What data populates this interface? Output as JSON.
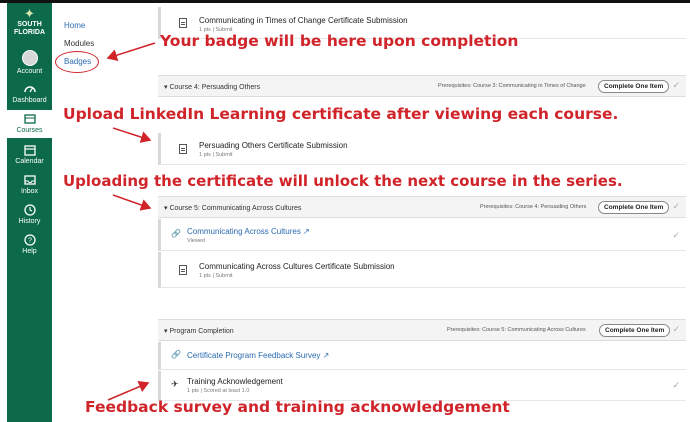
{
  "global_nav": {
    "logo": {
      "line1": "SOUTH",
      "line2": "FLORIDA"
    },
    "items": [
      {
        "label": "Account"
      },
      {
        "label": "Dashboard"
      },
      {
        "label": "Courses"
      },
      {
        "label": "Calendar"
      },
      {
        "label": "Inbox"
      },
      {
        "label": "History"
      },
      {
        "label": "Help"
      }
    ]
  },
  "course_nav": {
    "links": [
      "Home",
      "Modules",
      "Badges"
    ]
  },
  "content": {
    "item_top": {
      "title": "Communicating in Times of Change Certificate Submission",
      "meta": "1 pts | Submit"
    },
    "module4": {
      "title": "Course 4: Persuading Others",
      "prereq": "Prerequisites: Course 3: Communicating in Times of Change",
      "button": "Complete One Item"
    },
    "item_m4": {
      "title": "Persuading Others Certificate Submission",
      "meta": "1 pts | Submit"
    },
    "module5": {
      "title": "Course 5: Communicating Across Cultures",
      "prereq": "Prerequisites: Course 4: Persuading Others",
      "button": "Complete One Item"
    },
    "item_m5a": {
      "title": "Communicating Across Cultures",
      "meta": "Viewed"
    },
    "item_m5b": {
      "title": "Communicating Across Cultures Certificate Submission",
      "meta": "1 pts | Submit"
    },
    "module_pc": {
      "title": "Program Completion",
      "prereq": "Prerequisites: Course 5: Communicating Across Cultures",
      "button": "Complete One Item"
    },
    "item_pc1": {
      "title": "Certificate Program Feedback Survey"
    },
    "item_pc2": {
      "title": "Training Acknowledgement",
      "meta": "1 pts | Scored at least 1.0"
    }
  },
  "annotations": {
    "a1": "Your badge will be here upon completion",
    "a2": "Upload LinkedIn Learning certificate after viewing each course.",
    "a3": "Uploading the certificate will unlock the next course in the series.",
    "a4": "Feedback survey and training acknowledgement"
  },
  "colors": {
    "nav_green": "#0c6a4a",
    "annotation_red": "#d0242a",
    "link_blue": "#2a6ab0"
  }
}
